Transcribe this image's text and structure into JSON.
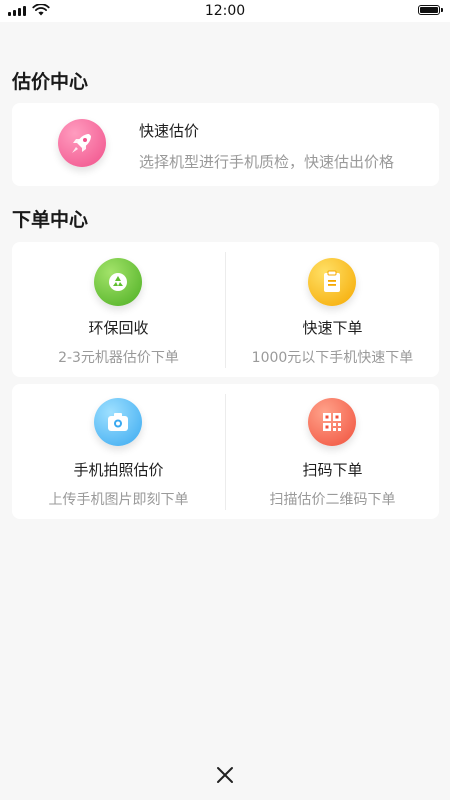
{
  "status_bar": {
    "time": "12:00"
  },
  "estimate_center": {
    "title": "估价中心",
    "quick_estimate": {
      "title": "快速估价",
      "description": "选择机型进行手机质检，快速估出价格",
      "icon": "rocket-icon"
    }
  },
  "order_center": {
    "title": "下单中心",
    "items": [
      {
        "title": "环保回收",
        "subtitle": "2-3元机器估价下单",
        "icon": "recycle-icon",
        "color": "#5fbf2e"
      },
      {
        "title": "快速下单",
        "subtitle": "1000元以下手机快速下单",
        "icon": "clipboard-icon",
        "color": "#f7b500"
      },
      {
        "title": "手机拍照估价",
        "subtitle": "上传手机图片即刻下单",
        "icon": "camera-icon",
        "color": "#4cb8f5"
      },
      {
        "title": "扫码下单",
        "subtitle": "扫描估价二维码下单",
        "icon": "qrcode-icon",
        "color": "#f5725d"
      }
    ]
  },
  "footer": {
    "close_icon": "close-icon"
  }
}
